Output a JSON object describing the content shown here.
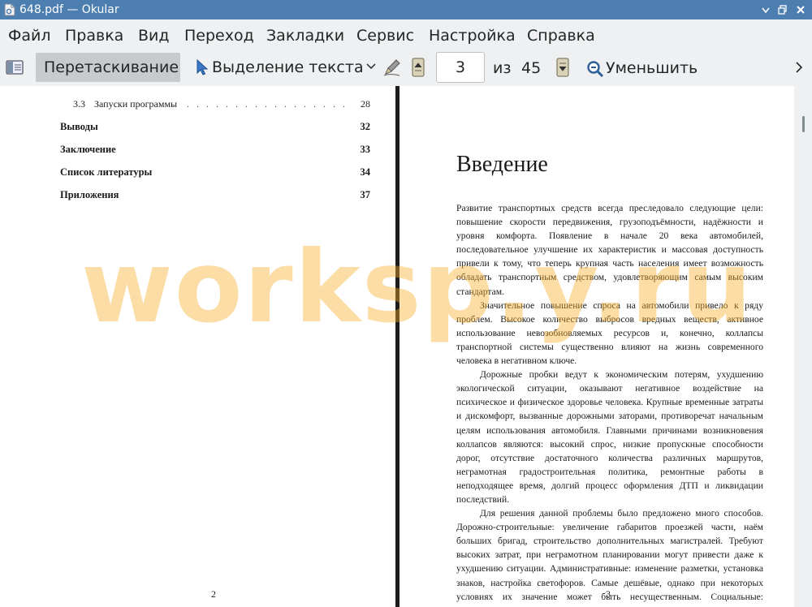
{
  "window": {
    "title": "648.pdf  — Okular"
  },
  "menu": {
    "items": [
      "Файл",
      "Правка",
      "Вид",
      "Переход",
      "Закладки",
      "Сервис",
      "Настройка",
      "Справка"
    ]
  },
  "toolbar": {
    "browse_label": "Перетаскивание",
    "select_label": "Выделение текста",
    "page_value": "3",
    "of_label": "из",
    "total_pages": "45",
    "zoom_out_label": "Уменьшить"
  },
  "left_page": {
    "toc": [
      {
        "num": "3.3",
        "title": "Запуски программы",
        "page": "28"
      },
      {
        "title": "Выводы",
        "page": "32"
      },
      {
        "title": "Заключение",
        "page": "33"
      },
      {
        "title": "Список литературы",
        "page": "34"
      },
      {
        "title": "Приложения",
        "page": "37"
      }
    ],
    "page_number": "2"
  },
  "right_page": {
    "heading": "Введение",
    "paragraphs": [
      "Развитие транспортных средств всегда преследовало следующие цели: повышение скорости передвижения, грузоподъёмности, надёжности и уровня комфорта. Появление в начале 20 века автомобилей, последовательное улучшение их характеристик и массовая доступность привели к тому, что теперь крупная часть населения имеет возможность обладать транспортным средством, удовлетворяющим самым высоким стандартам.",
      "Значительное повышение спроса на автомобили привело к ряду проблем. Высокое количество выбросов вредных веществ, активное использование невозобновляемых ресурсов и, конечно, коллапсы транспортной системы существенно влияют на жизнь современного человека в негативном ключе.",
      "Дорожные пробки ведут к экономическим потерям, ухудшению экологической ситуации, оказывают негативное воздействие на психическое и физическое здоровье человека. Крупные временные затраты и дискомфорт, вызванные дорожными заторами, противоречат начальным целям использования автомобиля. Главными причинами возникновения коллапсов являются: высокий спрос, низкие пропускные способности дорог, отсутствие достаточного количества различных маршрутов, неграмотная градостроительная политика, ремонтные работы в неподходящее время, долгий процесс оформления ДТП и ликвидации последствий.",
      "Для решения данной проблемы было предложено много способов. Дорожно-строительные: увеличение габаритов проезжей части, наём больших бригад, строительство дополнительных магистралей. Требуют высоких затрат, при неграмотном планировании могут привести даже к ухудшению ситуации. Административные: изменение разметки, установка знаков, настройка светофоров. Самые дешёвые, однако при некоторых условиях их значение может быть несущественным. Социальные: пропаганда ЗОЖ,"
    ],
    "page_number": "3"
  },
  "watermark": "worksp.y.ru"
}
